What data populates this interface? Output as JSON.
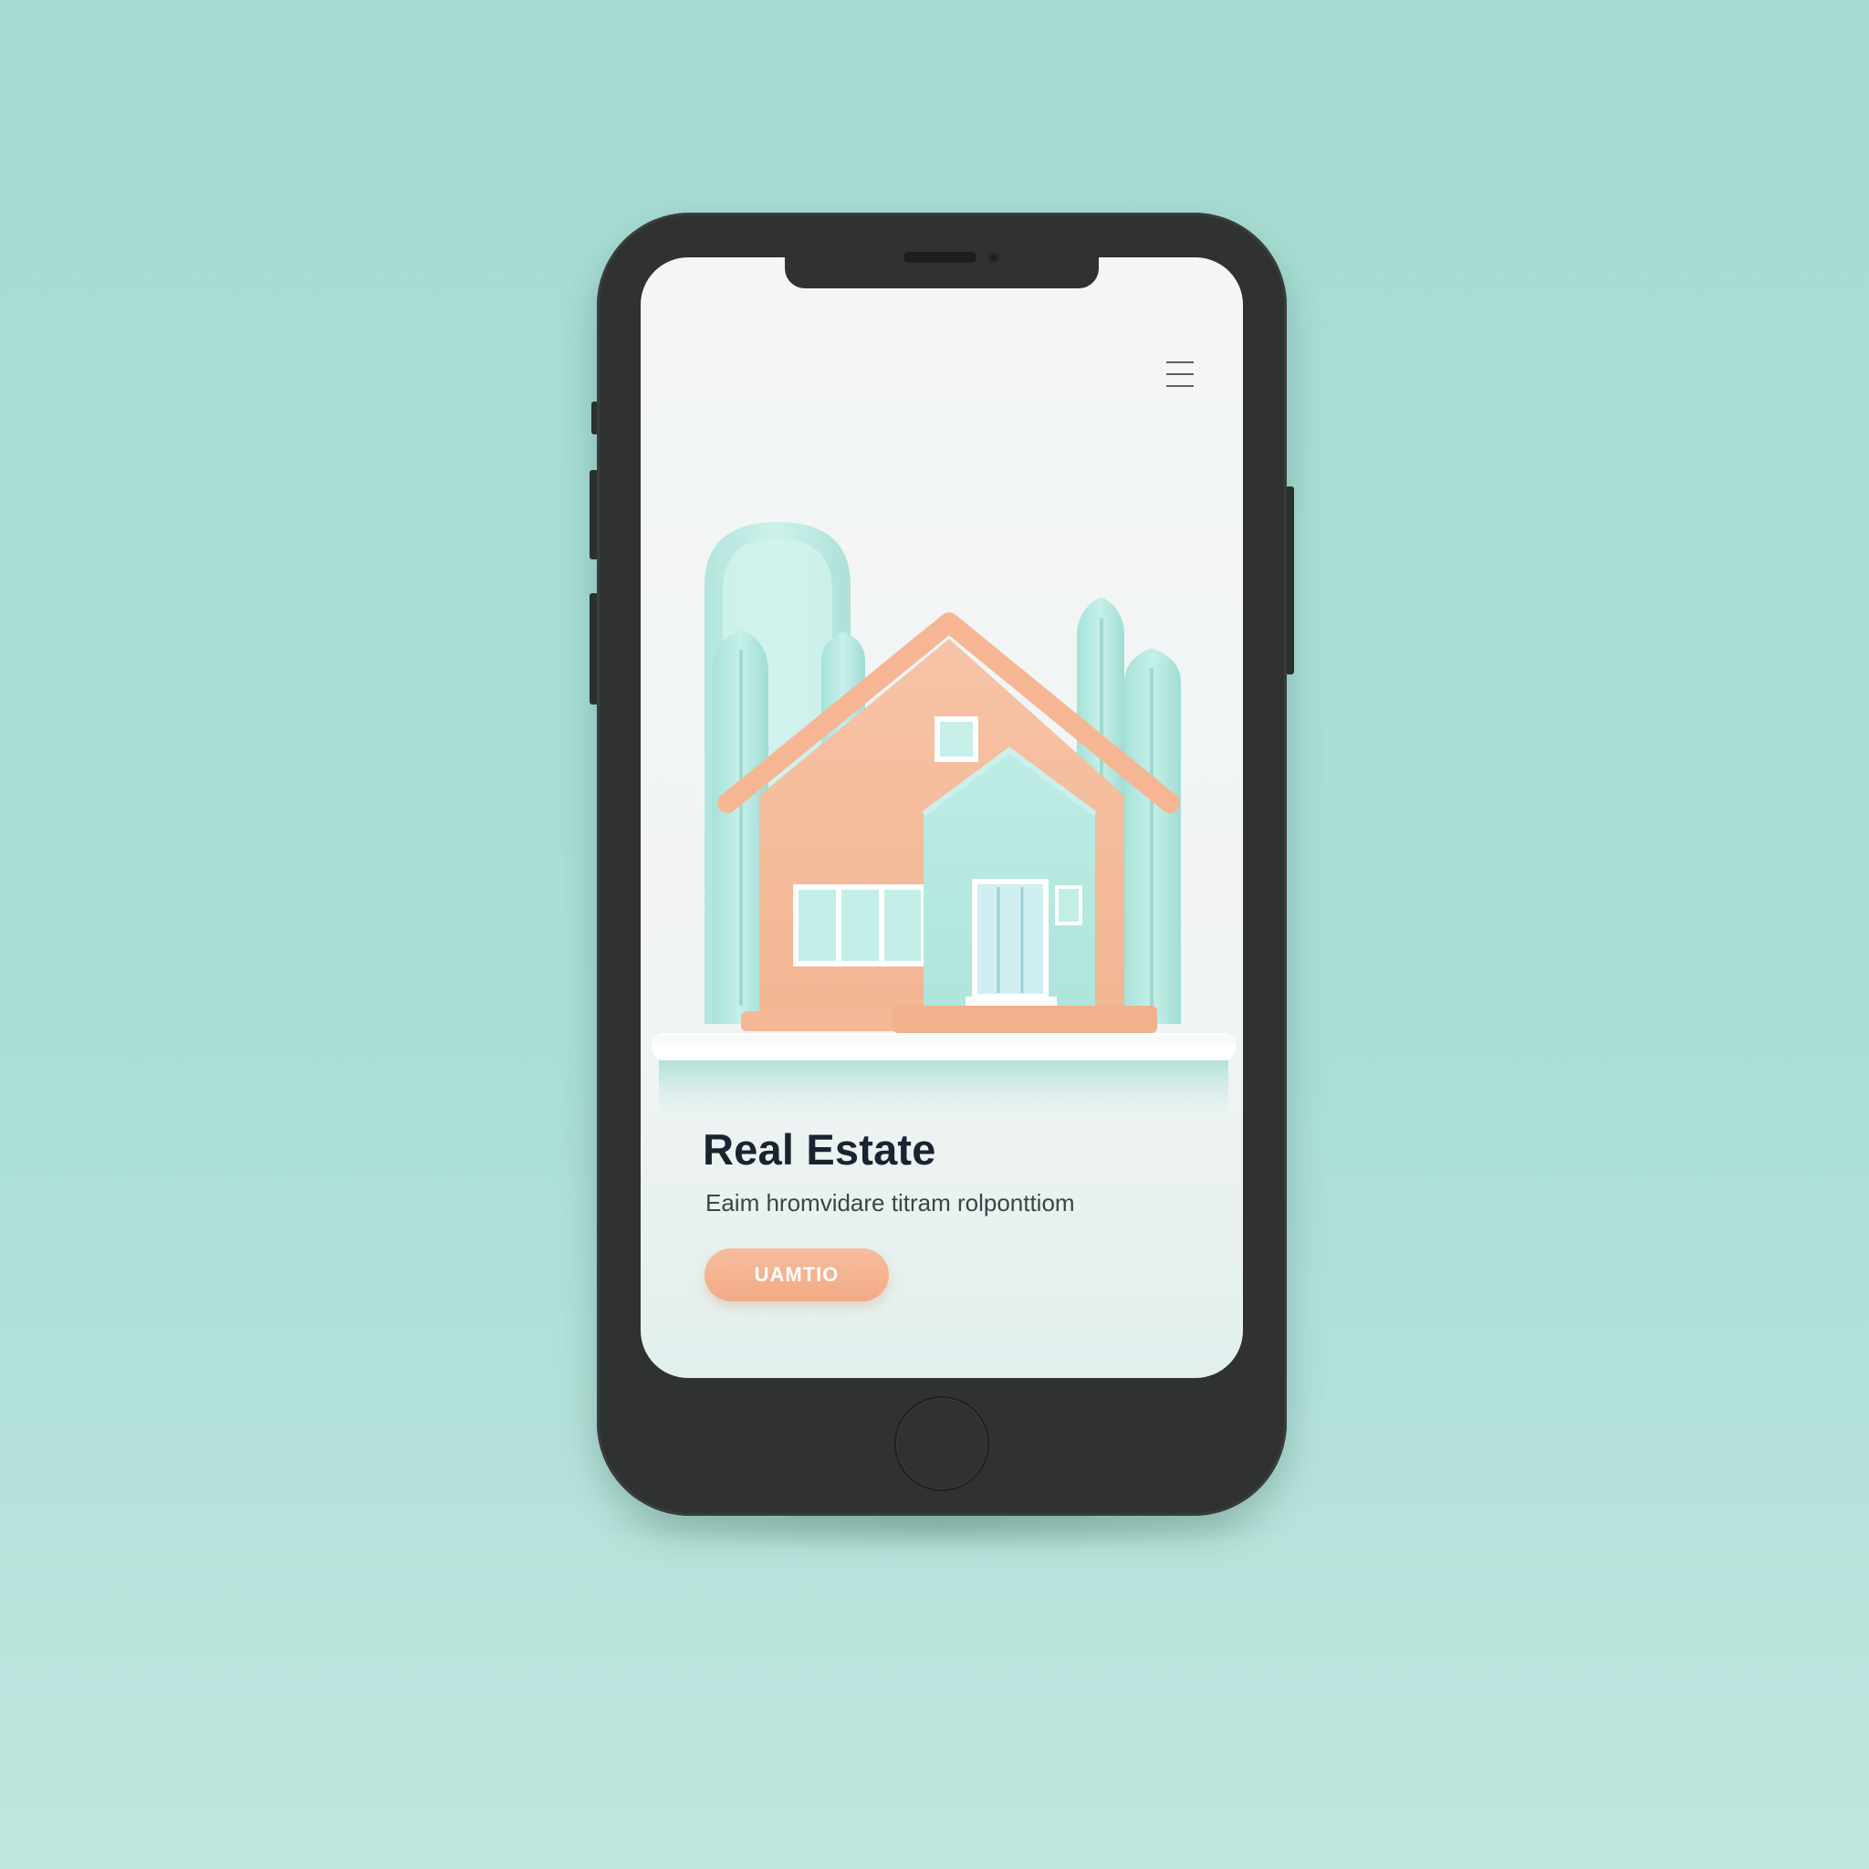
{
  "app": {
    "title": "Real Estate",
    "subtitle": "Eaim hromvidare titram rolponttiom",
    "cta_label": "UAMTIO"
  },
  "icons": {
    "menu": "hamburger-menu-icon",
    "illustration": "house-illustration"
  },
  "colors": {
    "background": "#a9ded5",
    "phone_frame": "#2f3230",
    "screen": "#f3f5f5",
    "accent_peach": "#f4b596",
    "accent_mint": "#b3e8df",
    "title_text": "#1b2330"
  }
}
